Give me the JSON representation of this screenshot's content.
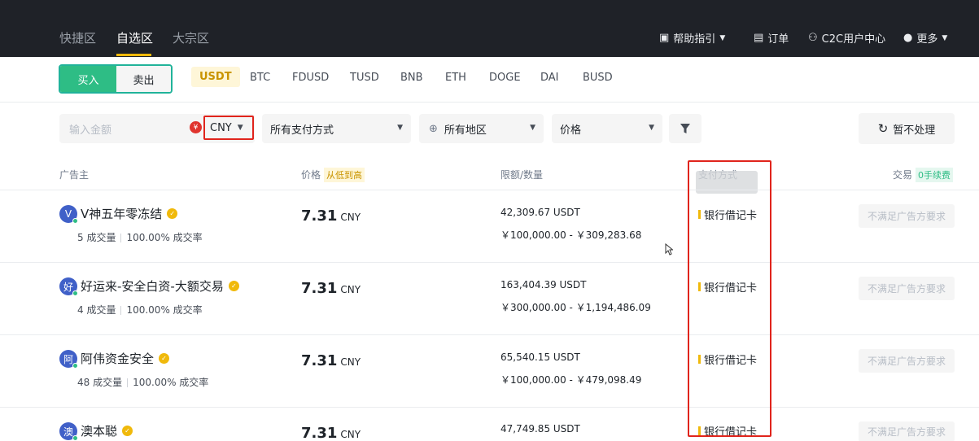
{
  "nav": {
    "tabs": [
      "快捷区",
      "自选区",
      "大宗区"
    ],
    "active_tab": "自选区",
    "help": "帮助指引",
    "orders": "订单",
    "c2c": "C2C用户中心",
    "more": "更多"
  },
  "trade": {
    "buy": "买入",
    "sell": "卖出",
    "coins": [
      "USDT",
      "BTC",
      "FDUSD",
      "TUSD",
      "BNB",
      "ETH",
      "DOGE",
      "DAI",
      "BUSD"
    ],
    "active_coin": "USDT"
  },
  "filters": {
    "amount_placeholder": "输入金额",
    "currency": "CNY",
    "currency_icon": "¥",
    "payment": "所有支付方式",
    "region": "所有地区",
    "sort": "价格",
    "refresh": "暂不处理"
  },
  "table": {
    "col_advertiser": "广告主",
    "col_price": "价格",
    "col_price_badge": "从低到高",
    "col_limit": "限额/数量",
    "col_payment": "支付方式",
    "col_trade": "交易",
    "col_trade_badge": "0手续费"
  },
  "rows": [
    {
      "avatar": "V",
      "name": "V神五年零冻结",
      "orders": "5 成交量",
      "rate": "100.00% 成交率",
      "price": "7.31",
      "currency": "CNY",
      "amount": "42,309.67 USDT",
      "limit": "￥100,000.00 - ￥309,283.68",
      "payment": "银行借记卡",
      "action": "不满足广告方要求"
    },
    {
      "avatar": "好",
      "name": "好运来-安全白资-大额交易",
      "orders": "4 成交量",
      "rate": "100.00% 成交率",
      "price": "7.31",
      "currency": "CNY",
      "amount": "163,404.39 USDT",
      "limit": "￥300,000.00 - ￥1,194,486.09",
      "payment": "银行借记卡",
      "action": "不满足广告方要求"
    },
    {
      "avatar": "阿",
      "name": "阿伟资金安全",
      "orders": "48 成交量",
      "rate": "100.00% 成交率",
      "price": "7.31",
      "currency": "CNY",
      "amount": "65,540.15 USDT",
      "limit": "￥100,000.00 - ￥479,098.49",
      "payment": "银行借记卡",
      "action": "不满足广告方要求"
    },
    {
      "avatar": "澳",
      "name": "澳本聪",
      "orders": "",
      "rate": "",
      "price": "7.31",
      "currency": "CNY",
      "amount": "47,749.85 USDT",
      "limit": "",
      "payment": "银行借记卡",
      "action": "不满足广告方要求"
    }
  ]
}
